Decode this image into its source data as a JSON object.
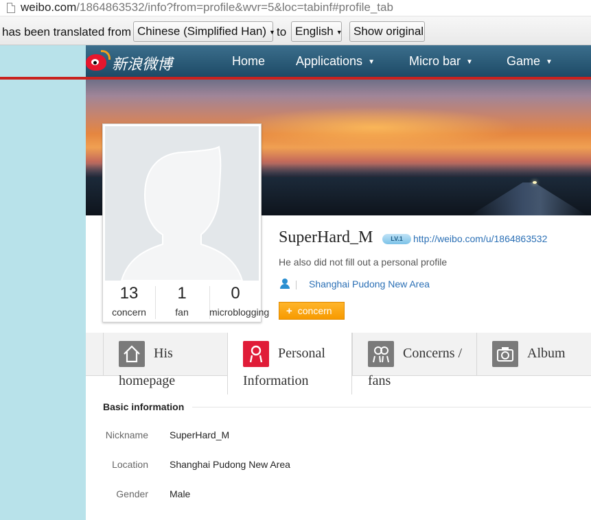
{
  "browser": {
    "url_host": "weibo.com",
    "url_path": "/1864863532/info?from=profile&wvr=5&loc=tabinf#profile_tab"
  },
  "translate_bar": {
    "prefix": "has been translated from",
    "from_language": "Chinese (Simplified Han)",
    "connector": "to",
    "to_language": "English",
    "show_original": "Show original"
  },
  "nav": {
    "logo_text": "新浪微博",
    "items": [
      {
        "label": "Home"
      },
      {
        "label": "Applications"
      },
      {
        "label": "Micro bar"
      },
      {
        "label": "Game"
      }
    ]
  },
  "profile": {
    "username": "SuperHard_M",
    "level": "LV.1",
    "url": "http://weibo.com/u/1864863532",
    "bio": "He also did not fill out a personal profile",
    "location": "Shanghai Pudong New Area",
    "follow_button": "concern",
    "stats": [
      {
        "value": "13",
        "label": "concern"
      },
      {
        "value": "1",
        "label": "fan"
      },
      {
        "value": "0",
        "label": "microblogging"
      }
    ]
  },
  "tabs": [
    {
      "line1": "His",
      "line2": "homepage",
      "icon": "home-icon",
      "active": false
    },
    {
      "line1": "Personal",
      "line2": "Information",
      "icon": "person-icon",
      "active": true
    },
    {
      "line1": "Concerns /",
      "line2": "fans",
      "icon": "people-icon",
      "active": false
    },
    {
      "line1": "Album",
      "line2": "",
      "icon": "camera-icon",
      "active": false
    }
  ],
  "basic_info": {
    "title": "Basic information",
    "rows": [
      {
        "label": "Nickname",
        "value": "SuperHard_M"
      },
      {
        "label": "Location",
        "value": "Shanghai Pudong New Area"
      },
      {
        "label": "Gender",
        "value": "Male"
      }
    ]
  },
  "colors": {
    "nav_bg": "#1d4a66",
    "accent_red": "#c9221f",
    "sidebar": "#b8e2ea",
    "link": "#2a6fb5",
    "follow_button": "#f79a00",
    "active_tab_icon": "#e01c38"
  }
}
